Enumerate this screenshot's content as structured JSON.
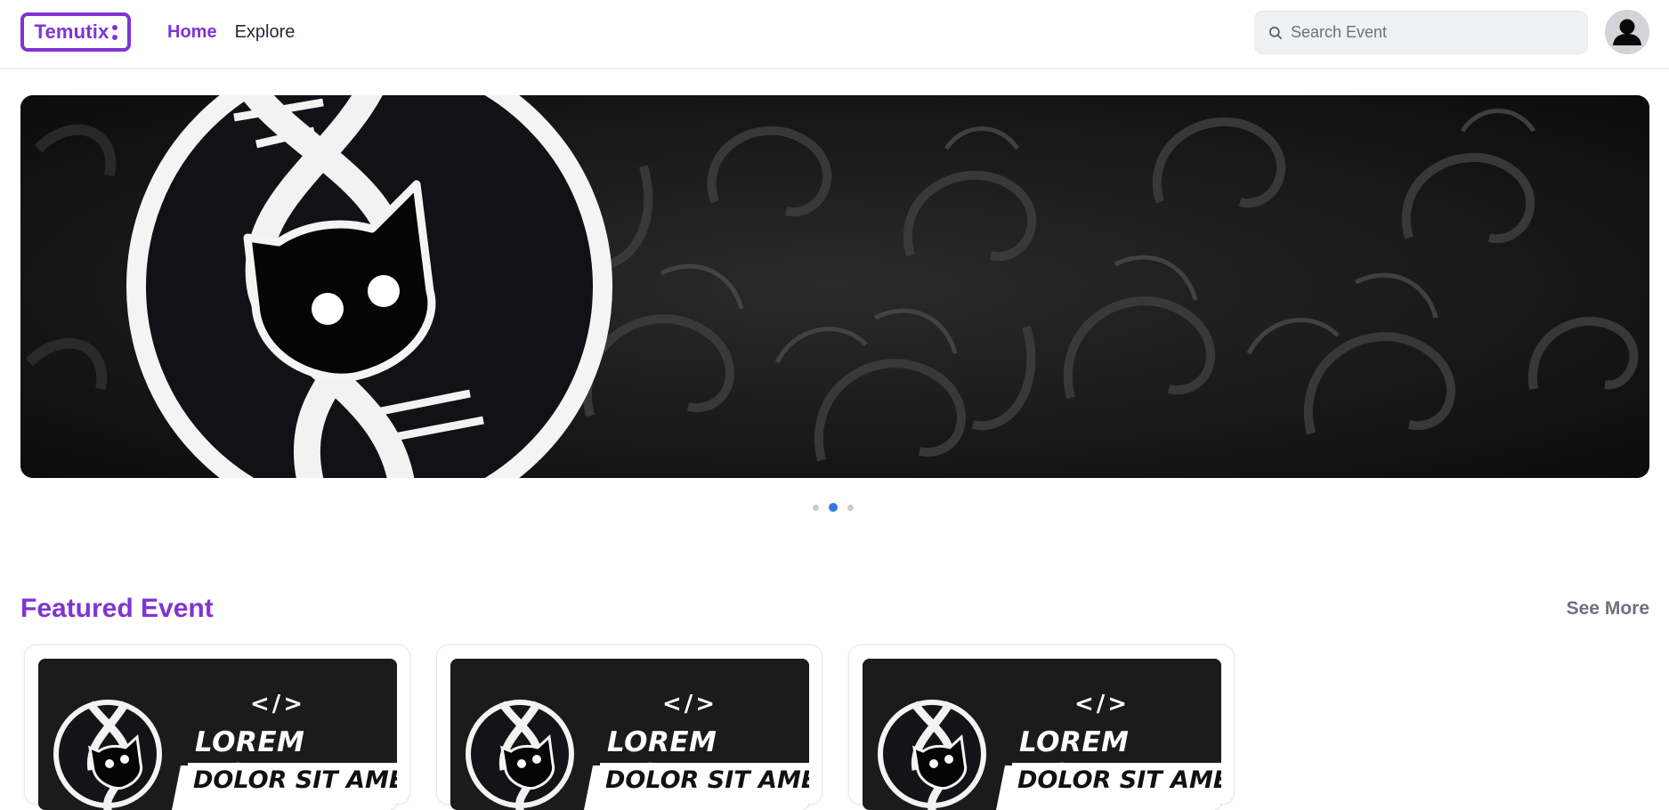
{
  "header": {
    "logo_text": "Temutix",
    "nav": [
      {
        "label": "Home",
        "active": true
      },
      {
        "label": "Explore",
        "active": false
      }
    ],
    "search": {
      "placeholder": "Search Event",
      "value": ""
    },
    "avatar_icon": "user-avatar-icon"
  },
  "carousel": {
    "slide_count": 3,
    "active_index": 1
  },
  "featured": {
    "title": "Featured Event",
    "see_more_label": "See More",
    "cards": [
      {
        "code_text": "</>",
        "title_line1": "LOREM IPSUM",
        "title_line2": "DOLOR SIT AMET"
      },
      {
        "code_text": "</>",
        "title_line1": "LOREM IPSUM",
        "title_line2": "DOLOR SIT AMET"
      },
      {
        "code_text": "</>",
        "title_line1": "LOREM IPSUM",
        "title_line2": "DOLOR SIT AMET"
      }
    ]
  },
  "colors": {
    "brand": "#7e34d4",
    "carousel_active_dot": "#2f7ae5",
    "muted_text": "#6b7280"
  }
}
